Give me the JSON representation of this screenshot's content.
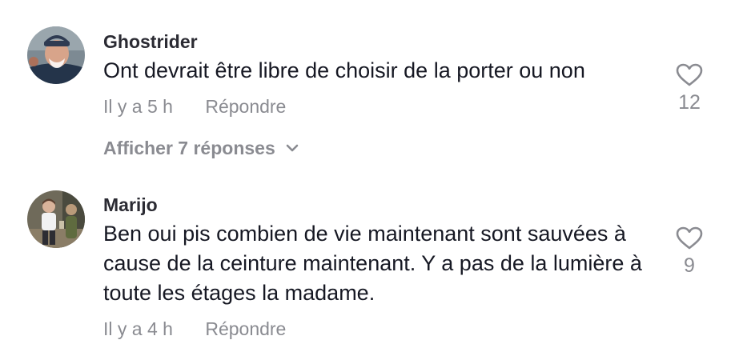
{
  "comments": [
    {
      "username": "Ghostrider",
      "text": "Ont devrait être libre de choisir de la porter ou non",
      "time": "Il y a 5 h",
      "reply_label": "Répondre",
      "likes": "12",
      "view_replies_label": "Afficher 7 réponses"
    },
    {
      "username": "Marijo",
      "text": "Ben oui pis combien de vie maintenant sont sauvées à cause de la ceinture maintenant. Y a pas de la lumière à toute les étages la madame.",
      "time": "Il y a 4 h",
      "reply_label": "Répondre",
      "likes": "9"
    }
  ],
  "icons": {
    "like": "heart-outline-icon",
    "expand": "chevron-down-icon"
  },
  "colors": {
    "primary_text": "#161823",
    "secondary_text": "#8a8b91"
  }
}
